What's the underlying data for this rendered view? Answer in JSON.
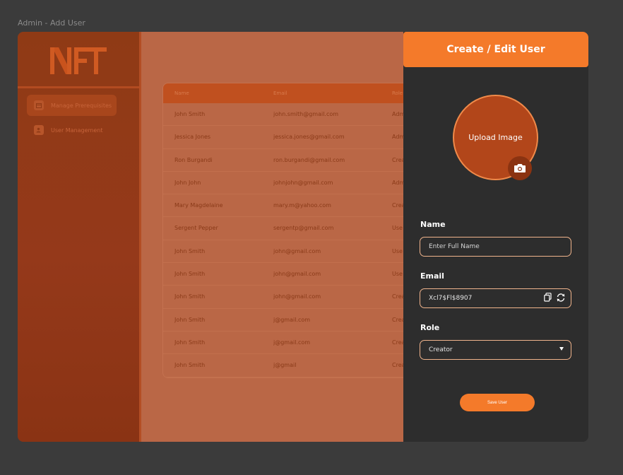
{
  "frame": {
    "title": "Admin - Add User"
  },
  "sidebar": {
    "logo": "NFT",
    "items": [
      {
        "label": "Manage Prerequisites",
        "icon": "calendar-icon",
        "active": true
      },
      {
        "label": "User Management",
        "icon": "user-settings-icon",
        "active": false
      }
    ]
  },
  "table": {
    "columns": [
      "Name",
      "Email",
      "Role"
    ],
    "rows": [
      {
        "name": "John Smith",
        "email": "john.smith@gmail.com",
        "role": "Adm"
      },
      {
        "name": "Jessica Jones",
        "email": "jessica.jones@gmail.com",
        "role": "Adm"
      },
      {
        "name": "Ron Burgandi",
        "email": "ron.burgandi@gmail.com",
        "role": "Crea"
      },
      {
        "name": "John John",
        "email": "johnjohn@gmail.com",
        "role": "Adm"
      },
      {
        "name": "Mary Magdelaine",
        "email": "mary.m@yahoo.com",
        "role": "Crea"
      },
      {
        "name": "Sergent Pepper",
        "email": "sergentp@gmail.com",
        "role": "Use"
      },
      {
        "name": "John Smith",
        "email": "john@gmail.com",
        "role": "Use"
      },
      {
        "name": "John Smith",
        "email": "john@gmail.com",
        "role": "Use"
      },
      {
        "name": "John Smith",
        "email": "john@gmail.com",
        "role": "Crea"
      },
      {
        "name": "John Smith",
        "email": "j@gmail.com",
        "role": "Crea"
      },
      {
        "name": "John Smith",
        "email": "j@gmail.com",
        "role": "Crea"
      },
      {
        "name": "John Smith",
        "email": "j@gmail",
        "role": "Crea"
      }
    ]
  },
  "panel": {
    "title": "Create / Edit User",
    "upload_label": "Upload Image",
    "name_label": "Name",
    "name_placeholder": "Enter Full Name",
    "email_label": "Email",
    "email_value": "Xcl7$Fl$8907",
    "role_label": "Role",
    "role_value": "Creator",
    "save_label": "Save User"
  },
  "colors": {
    "accent": "#f47a2a",
    "panel_bg": "#2d2d2d",
    "sidebar_bg": "#8f3a15",
    "main_overlay": "#ba6746"
  }
}
